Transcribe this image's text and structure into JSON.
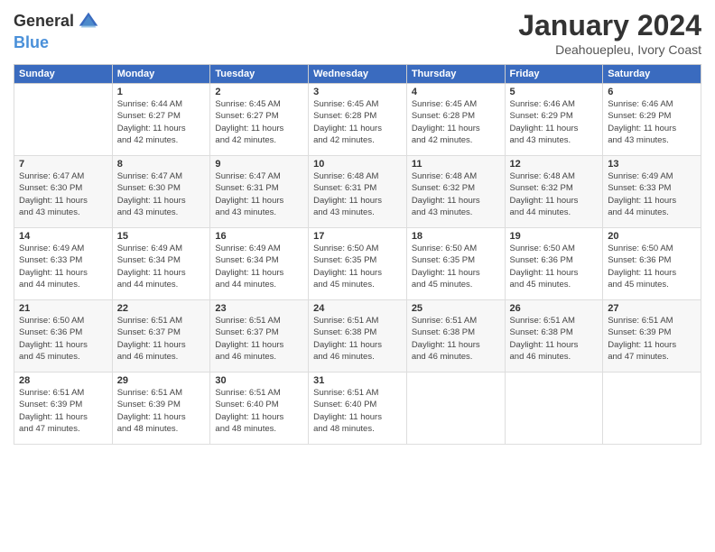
{
  "header": {
    "logo_general": "General",
    "logo_blue": "Blue",
    "month_title": "January 2024",
    "location": "Deahouepleu, Ivory Coast"
  },
  "weekdays": [
    "Sunday",
    "Monday",
    "Tuesday",
    "Wednesday",
    "Thursday",
    "Friday",
    "Saturday"
  ],
  "weeks": [
    [
      {
        "day": "",
        "sunrise": "",
        "sunset": "",
        "daylight": ""
      },
      {
        "day": "1",
        "sunrise": "Sunrise: 6:44 AM",
        "sunset": "Sunset: 6:27 PM",
        "daylight": "Daylight: 11 hours and 42 minutes."
      },
      {
        "day": "2",
        "sunrise": "Sunrise: 6:45 AM",
        "sunset": "Sunset: 6:27 PM",
        "daylight": "Daylight: 11 hours and 42 minutes."
      },
      {
        "day": "3",
        "sunrise": "Sunrise: 6:45 AM",
        "sunset": "Sunset: 6:28 PM",
        "daylight": "Daylight: 11 hours and 42 minutes."
      },
      {
        "day": "4",
        "sunrise": "Sunrise: 6:45 AM",
        "sunset": "Sunset: 6:28 PM",
        "daylight": "Daylight: 11 hours and 42 minutes."
      },
      {
        "day": "5",
        "sunrise": "Sunrise: 6:46 AM",
        "sunset": "Sunset: 6:29 PM",
        "daylight": "Daylight: 11 hours and 43 minutes."
      },
      {
        "day": "6",
        "sunrise": "Sunrise: 6:46 AM",
        "sunset": "Sunset: 6:29 PM",
        "daylight": "Daylight: 11 hours and 43 minutes."
      }
    ],
    [
      {
        "day": "7",
        "sunrise": "Sunrise: 6:47 AM",
        "sunset": "Sunset: 6:30 PM",
        "daylight": "Daylight: 11 hours and 43 minutes."
      },
      {
        "day": "8",
        "sunrise": "Sunrise: 6:47 AM",
        "sunset": "Sunset: 6:30 PM",
        "daylight": "Daylight: 11 hours and 43 minutes."
      },
      {
        "day": "9",
        "sunrise": "Sunrise: 6:47 AM",
        "sunset": "Sunset: 6:31 PM",
        "daylight": "Daylight: 11 hours and 43 minutes."
      },
      {
        "day": "10",
        "sunrise": "Sunrise: 6:48 AM",
        "sunset": "Sunset: 6:31 PM",
        "daylight": "Daylight: 11 hours and 43 minutes."
      },
      {
        "day": "11",
        "sunrise": "Sunrise: 6:48 AM",
        "sunset": "Sunset: 6:32 PM",
        "daylight": "Daylight: 11 hours and 43 minutes."
      },
      {
        "day": "12",
        "sunrise": "Sunrise: 6:48 AM",
        "sunset": "Sunset: 6:32 PM",
        "daylight": "Daylight: 11 hours and 44 minutes."
      },
      {
        "day": "13",
        "sunrise": "Sunrise: 6:49 AM",
        "sunset": "Sunset: 6:33 PM",
        "daylight": "Daylight: 11 hours and 44 minutes."
      }
    ],
    [
      {
        "day": "14",
        "sunrise": "Sunrise: 6:49 AM",
        "sunset": "Sunset: 6:33 PM",
        "daylight": "Daylight: 11 hours and 44 minutes."
      },
      {
        "day": "15",
        "sunrise": "Sunrise: 6:49 AM",
        "sunset": "Sunset: 6:34 PM",
        "daylight": "Daylight: 11 hours and 44 minutes."
      },
      {
        "day": "16",
        "sunrise": "Sunrise: 6:49 AM",
        "sunset": "Sunset: 6:34 PM",
        "daylight": "Daylight: 11 hours and 44 minutes."
      },
      {
        "day": "17",
        "sunrise": "Sunrise: 6:50 AM",
        "sunset": "Sunset: 6:35 PM",
        "daylight": "Daylight: 11 hours and 45 minutes."
      },
      {
        "day": "18",
        "sunrise": "Sunrise: 6:50 AM",
        "sunset": "Sunset: 6:35 PM",
        "daylight": "Daylight: 11 hours and 45 minutes."
      },
      {
        "day": "19",
        "sunrise": "Sunrise: 6:50 AM",
        "sunset": "Sunset: 6:36 PM",
        "daylight": "Daylight: 11 hours and 45 minutes."
      },
      {
        "day": "20",
        "sunrise": "Sunrise: 6:50 AM",
        "sunset": "Sunset: 6:36 PM",
        "daylight": "Daylight: 11 hours and 45 minutes."
      }
    ],
    [
      {
        "day": "21",
        "sunrise": "Sunrise: 6:50 AM",
        "sunset": "Sunset: 6:36 PM",
        "daylight": "Daylight: 11 hours and 45 minutes."
      },
      {
        "day": "22",
        "sunrise": "Sunrise: 6:51 AM",
        "sunset": "Sunset: 6:37 PM",
        "daylight": "Daylight: 11 hours and 46 minutes."
      },
      {
        "day": "23",
        "sunrise": "Sunrise: 6:51 AM",
        "sunset": "Sunset: 6:37 PM",
        "daylight": "Daylight: 11 hours and 46 minutes."
      },
      {
        "day": "24",
        "sunrise": "Sunrise: 6:51 AM",
        "sunset": "Sunset: 6:38 PM",
        "daylight": "Daylight: 11 hours and 46 minutes."
      },
      {
        "day": "25",
        "sunrise": "Sunrise: 6:51 AM",
        "sunset": "Sunset: 6:38 PM",
        "daylight": "Daylight: 11 hours and 46 minutes."
      },
      {
        "day": "26",
        "sunrise": "Sunrise: 6:51 AM",
        "sunset": "Sunset: 6:38 PM",
        "daylight": "Daylight: 11 hours and 46 minutes."
      },
      {
        "day": "27",
        "sunrise": "Sunrise: 6:51 AM",
        "sunset": "Sunset: 6:39 PM",
        "daylight": "Daylight: 11 hours and 47 minutes."
      }
    ],
    [
      {
        "day": "28",
        "sunrise": "Sunrise: 6:51 AM",
        "sunset": "Sunset: 6:39 PM",
        "daylight": "Daylight: 11 hours and 47 minutes."
      },
      {
        "day": "29",
        "sunrise": "Sunrise: 6:51 AM",
        "sunset": "Sunset: 6:39 PM",
        "daylight": "Daylight: 11 hours and 48 minutes."
      },
      {
        "day": "30",
        "sunrise": "Sunrise: 6:51 AM",
        "sunset": "Sunset: 6:40 PM",
        "daylight": "Daylight: 11 hours and 48 minutes."
      },
      {
        "day": "31",
        "sunrise": "Sunrise: 6:51 AM",
        "sunset": "Sunset: 6:40 PM",
        "daylight": "Daylight: 11 hours and 48 minutes."
      },
      {
        "day": "",
        "sunrise": "",
        "sunset": "",
        "daylight": ""
      },
      {
        "day": "",
        "sunrise": "",
        "sunset": "",
        "daylight": ""
      },
      {
        "day": "",
        "sunrise": "",
        "sunset": "",
        "daylight": ""
      }
    ]
  ]
}
